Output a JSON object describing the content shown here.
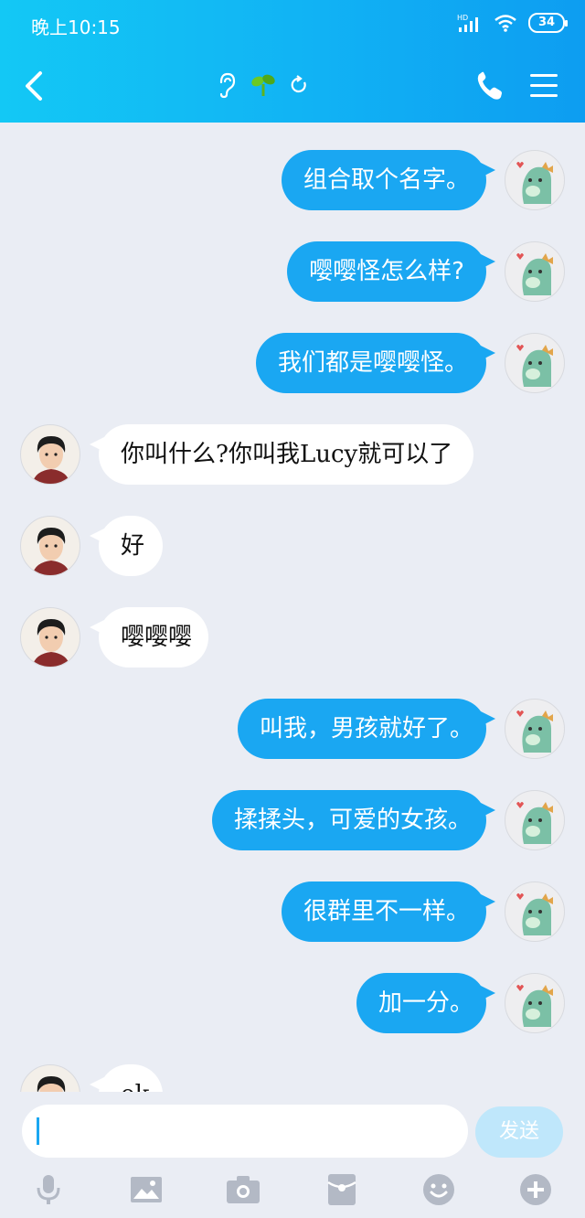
{
  "status_bar": {
    "time": "晚上10:15",
    "network": "HD",
    "battery": "34"
  },
  "header": {
    "icons": [
      "ear-icon",
      "sprout-icon",
      "refresh-icon"
    ]
  },
  "colors": {
    "header": "#11b2f4",
    "outgoing_bubble": "#1aa7f2",
    "incoming_bubble": "#ffffff",
    "background": "#eaedf4"
  },
  "messages": [
    {
      "side": "out",
      "text": "组合取个名字。"
    },
    {
      "side": "out",
      "text": "嘤嘤怪怎么样?"
    },
    {
      "side": "out",
      "text": "我们都是嘤嘤怪。"
    },
    {
      "side": "in",
      "text": "你叫什么?你叫我Lucy就可以了"
    },
    {
      "side": "in",
      "text": "好"
    },
    {
      "side": "in",
      "text": "嘤嘤嘤"
    },
    {
      "side": "out",
      "text": "叫我，男孩就好了。"
    },
    {
      "side": "out",
      "text": "揉揉头，可爱的女孩。"
    },
    {
      "side": "out",
      "text": "很群里不一样。"
    },
    {
      "side": "out",
      "text": "加一分。"
    },
    {
      "side": "in",
      "text": "ok"
    }
  ],
  "input": {
    "value": "",
    "send_label": "发送"
  },
  "toolbar": [
    "microphone-icon",
    "image-icon",
    "camera-icon",
    "red-packet-icon",
    "emoji-icon",
    "plus-icon"
  ]
}
